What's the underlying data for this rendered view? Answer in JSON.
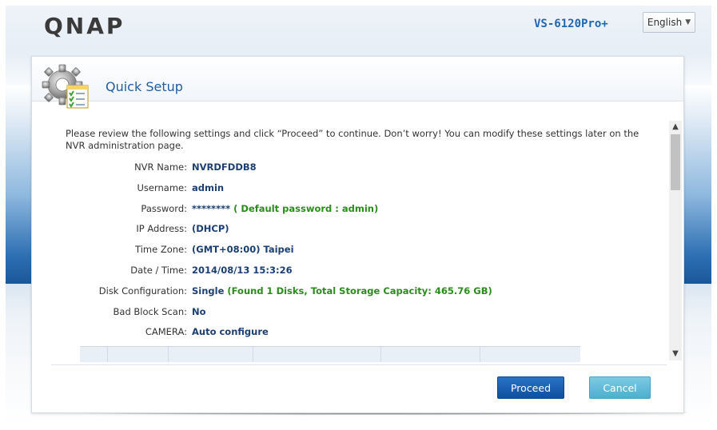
{
  "header": {
    "logo": "QNAP",
    "model": "VS-6120Pro+",
    "language": "English"
  },
  "dialog": {
    "title": "Quick Setup",
    "intro": "Please review the following settings and click “Proceed” to continue. Don’t worry! You can modify these settings later on the NVR administration page.",
    "settings": [
      {
        "label": "NVR Name:",
        "value": "NVRDFDDB8",
        "note": ""
      },
      {
        "label": "Username:",
        "value": "admin",
        "note": ""
      },
      {
        "label": "Password:",
        "value": "********",
        "note": "( Default password : admin)"
      },
      {
        "label": "IP Address:",
        "value": "(DHCP)",
        "note": ""
      },
      {
        "label": "Time Zone:",
        "value": "(GMT+08:00) Taipei",
        "note": ""
      },
      {
        "label": "Date / Time:",
        "value": "2014/08/13 15:3:26",
        "note": ""
      },
      {
        "label": "Disk Configuration:",
        "value": "Single",
        "note": "(Found 1 Disks, Total Storage Capacity: 465.76 GB)"
      },
      {
        "label": "Bad Block Scan:",
        "value": "No",
        "note": ""
      },
      {
        "label": "CAMERA:",
        "value": "Auto configure",
        "note": ""
      }
    ],
    "buttons": {
      "proceed": "Proceed",
      "cancel": "Cancel"
    }
  },
  "colors": {
    "accent": "#1f66b3",
    "value_text": "#1b3f73",
    "note_text": "#2c8a1e",
    "proceed_bg": "#1a5fae",
    "cancel_bg": "#5db8d6"
  },
  "icons": {
    "dialog": "gear-checklist-icon",
    "language_caret": "chevron-down-icon",
    "scroll_up": "arrow-up-icon",
    "scroll_down": "arrow-down-icon"
  }
}
